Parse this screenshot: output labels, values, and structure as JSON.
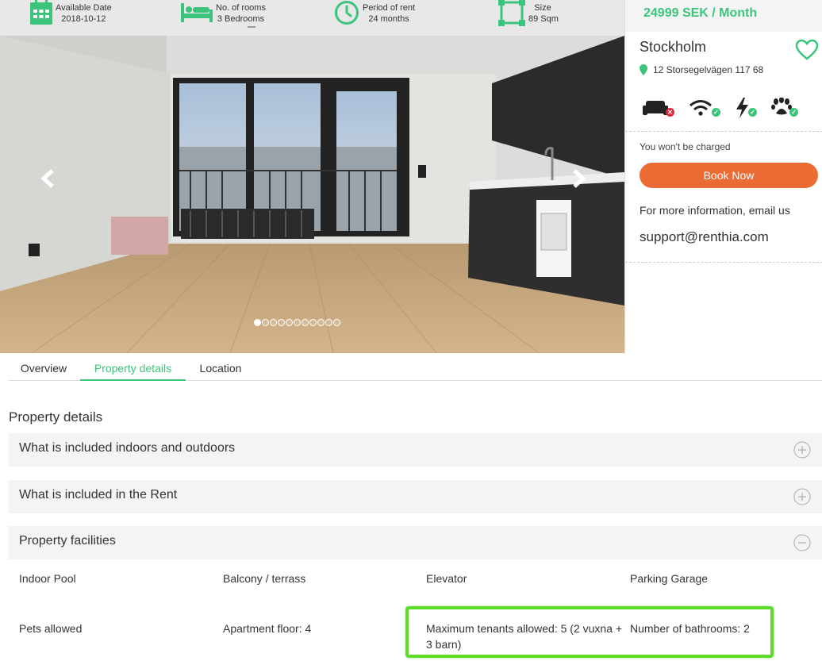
{
  "info_bar": {
    "available_date_label": "Available Date",
    "available_date_value": "2018-10-12",
    "rooms_label": "No. of rooms",
    "rooms_value": "3 Bedrooms",
    "period_label": "Period of rent",
    "period_value": "24 months",
    "size_label": "Size",
    "size_value": "89 Sqm",
    "icons": [
      "calendar-icon",
      "bed-icon",
      "clock-icon",
      "size-frame-icon"
    ]
  },
  "carousel": {
    "slide_count": 11,
    "active_slide": 1,
    "icons": [
      "arrow-left-icon",
      "arrow-right-icon"
    ]
  },
  "sidebar": {
    "price": "24999 SEK / Month",
    "city": "Stockholm",
    "address": "12 Storsegelvägen 117 68",
    "charge_note": "You won't be charged",
    "book_label": "Book Now",
    "email_label": "For more information, email us",
    "email": "support@renthia.com",
    "amenities": [
      {
        "icon": "sofa-icon",
        "available": false
      },
      {
        "icon": "wifi-icon",
        "available": true
      },
      {
        "icon": "electricity-icon",
        "available": true
      },
      {
        "icon": "paw-icon",
        "available": true
      }
    ],
    "colors": {
      "accent": "#3cc47c",
      "book_button": "#eb6b35",
      "unavailable": "#e0283a"
    }
  },
  "tabs": [
    {
      "label": "Overview",
      "active": false
    },
    {
      "label": "Property details",
      "active": true
    },
    {
      "label": "Location",
      "active": false
    }
  ],
  "details": {
    "title": "Property details",
    "sections": [
      {
        "title": "What is included indoors and outdoors",
        "expanded": false
      },
      {
        "title": "What is included in the Rent",
        "expanded": false
      },
      {
        "title": "Property facilities",
        "expanded": true
      }
    ],
    "facilities": [
      "Indoor Pool",
      "Balcony / terrass",
      "Elevator",
      "Parking Garage",
      "Pets allowed",
      "Apartment floor: 4",
      "Maximum tenants allowed: 5 (2 vuxna + 3 barn)",
      "Number of bathrooms: 2"
    ],
    "highlight_color": "#5bdc29"
  }
}
